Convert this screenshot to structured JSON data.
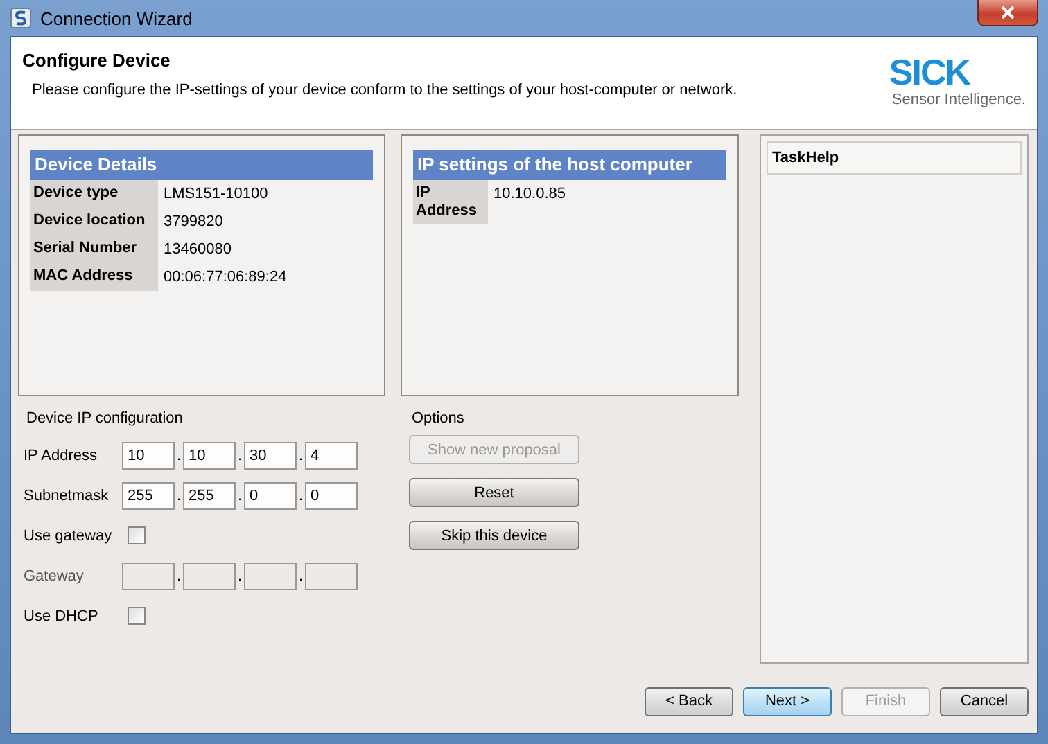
{
  "window": {
    "title": "Connection Wizard"
  },
  "header": {
    "title": "Configure Device",
    "description": "Please configure the IP-settings of your device conform to the settings of your host-computer or network.",
    "logo": {
      "brand": "SICK",
      "tagline": "Sensor Intelligence."
    }
  },
  "device_details": {
    "title": "Device Details",
    "rows": [
      {
        "label": "Device type",
        "value": "LMS151-10100"
      },
      {
        "label": "Device location",
        "value": "3799820"
      },
      {
        "label": "Serial Number",
        "value": "13460080"
      },
      {
        "label": "MAC Address",
        "value": "00:06:77:06:89:24"
      }
    ]
  },
  "host_settings": {
    "title": "IP settings of the host computer",
    "rows": [
      {
        "label": "IP Address",
        "value": "10.10.0.85"
      }
    ]
  },
  "ip_config": {
    "title": "Device IP configuration",
    "separator": ".",
    "rows": [
      {
        "kind": "octets",
        "label": "IP Address",
        "disabled": false,
        "octets": [
          "10",
          "10",
          "30",
          "4"
        ]
      },
      {
        "kind": "octets",
        "label": "Subnetmask",
        "disabled": false,
        "octets": [
          "255",
          "255",
          "0",
          "0"
        ]
      },
      {
        "kind": "checkbox",
        "label": "Use gateway",
        "checked": false
      },
      {
        "kind": "octets",
        "label": "Gateway",
        "disabled": true
      },
      {
        "kind": "checkbox",
        "label": "Use DHCP",
        "checked": false
      }
    ]
  },
  "options": {
    "title": "Options",
    "buttons": [
      {
        "label": "Show new proposal",
        "disabled": true
      },
      {
        "label": "Reset",
        "disabled": false
      },
      {
        "label": "Skip this device",
        "disabled": false
      }
    ]
  },
  "task_help": {
    "title": "TaskHelp"
  },
  "footer": {
    "buttons": [
      {
        "label": "< Back",
        "disabled": false,
        "default": false
      },
      {
        "label": "Next >",
        "disabled": false,
        "default": true
      },
      {
        "label": "Finish",
        "disabled": true,
        "default": false
      },
      {
        "label": "Cancel",
        "disabled": false,
        "default": false
      }
    ]
  }
}
